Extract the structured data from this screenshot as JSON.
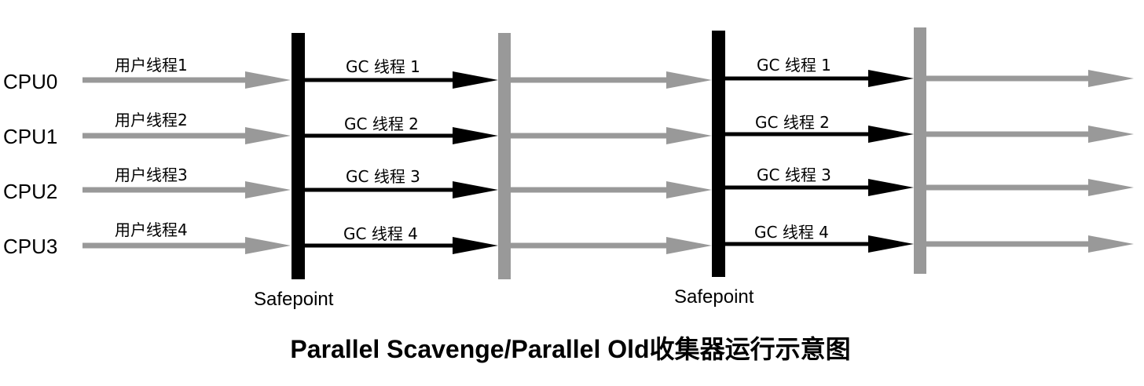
{
  "cpus": [
    "CPU0",
    "CPU1",
    "CPU2",
    "CPU3"
  ],
  "user_threads": [
    "用户线程1",
    "用户线程2",
    "用户线程3",
    "用户线程4"
  ],
  "gc_threads_phase1": [
    "GC 线程 1",
    "GC 线程 2",
    "GC 线程 3",
    "GC 线程 4"
  ],
  "gc_threads_phase2": [
    "GC 线程 1",
    "GC 线程 2",
    "GC 线程 3",
    "GC 线程 4"
  ],
  "safepoints": [
    "Safepoint",
    "Safepoint"
  ],
  "title": "Parallel Scavenge/Parallel Old收集器运行示意图",
  "colors": {
    "user_thread": "#999999",
    "gc_thread": "#000000",
    "safepoint_bar": "#000000",
    "resume_bar": "#999999"
  }
}
